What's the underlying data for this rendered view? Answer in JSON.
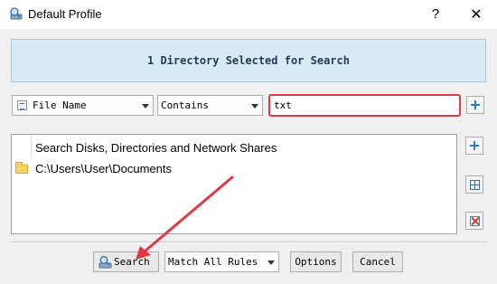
{
  "window": {
    "title": "Default Profile",
    "help_label": "?",
    "close_label": "✕"
  },
  "banner": {
    "text": "1 Directory Selected for Search"
  },
  "rule": {
    "field": "File Name",
    "operator": "Contains",
    "value": "txt"
  },
  "locations": {
    "header": "Search Disks, Directories and Network Shares",
    "items": [
      "C:\\Users\\User\\Documents"
    ]
  },
  "footer": {
    "search_label": "Search",
    "match_mode": "Match All Rules",
    "options_label": "Options",
    "cancel_label": "Cancel"
  },
  "colors": {
    "highlight_border": "#de3a46",
    "annotation_arrow": "#de3a46",
    "banner_bg": "#d9eaf7"
  }
}
